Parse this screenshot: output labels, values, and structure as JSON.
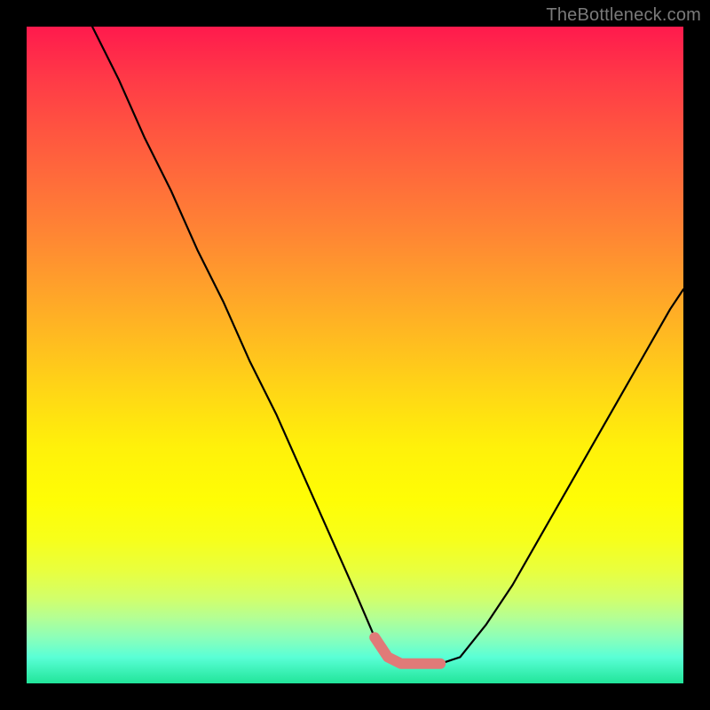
{
  "watermark": "TheBottleneck.com",
  "chart_data": {
    "type": "line",
    "title": "",
    "xlabel": "",
    "ylabel": "",
    "xlim": [
      0,
      100
    ],
    "ylim": [
      0,
      100
    ],
    "series": [
      {
        "name": "bottleneck-curve",
        "x": [
          10,
          14,
          18,
          22,
          26,
          30,
          34,
          38,
          42,
          46,
          50,
          53,
          55,
          57,
          59,
          61,
          63,
          66,
          70,
          74,
          78,
          82,
          86,
          90,
          94,
          98,
          100
        ],
        "values": [
          100,
          92,
          83,
          75,
          66,
          58,
          49,
          41,
          32,
          23,
          14,
          7,
          4,
          3,
          3,
          3,
          3,
          4,
          9,
          15,
          22,
          29,
          36,
          43,
          50,
          57,
          60
        ]
      }
    ],
    "highlight_segment": {
      "x_start": 53,
      "x_end": 63,
      "y": 3,
      "color": "#e07a78"
    },
    "gradient_colors_top_to_bottom": [
      "#ff1a4d",
      "#ffbd20",
      "#fff10a",
      "#21e59a"
    ]
  }
}
